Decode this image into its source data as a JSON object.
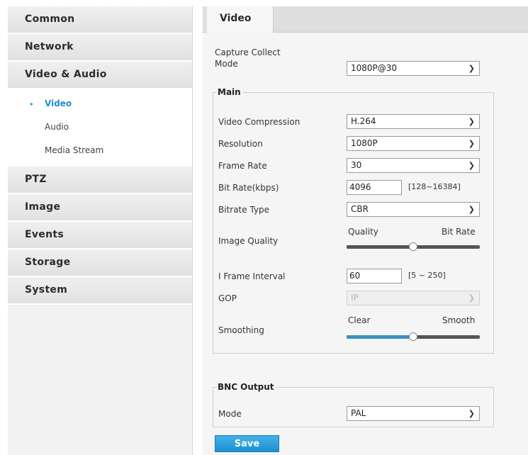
{
  "sidebar": {
    "items": [
      {
        "label": "Common"
      },
      {
        "label": "Network"
      },
      {
        "label": "Video & Audio"
      },
      {
        "label": "PTZ"
      },
      {
        "label": "Image"
      },
      {
        "label": "Events"
      },
      {
        "label": "Storage"
      },
      {
        "label": "System"
      }
    ],
    "sub_items": [
      {
        "label": "Video",
        "active": true
      },
      {
        "label": "Audio"
      },
      {
        "label": "Media Stream"
      }
    ],
    "active_arrow": "▸"
  },
  "tabs": [
    {
      "label": "Video"
    }
  ],
  "capture": {
    "label_line1": "Capture Collect",
    "label_line2": "Mode",
    "value": "1080P@30"
  },
  "main": {
    "legend": "Main",
    "video_compression": {
      "label": "Video Compression",
      "value": "H.264"
    },
    "resolution": {
      "label": "Resolution",
      "value": "1080P"
    },
    "frame_rate": {
      "label": "Frame Rate",
      "value": "30"
    },
    "bit_rate": {
      "label": "Bit Rate(kbps)",
      "value": "4096",
      "range": "[128~16384]"
    },
    "bitrate_type": {
      "label": "Bitrate Type",
      "value": "CBR"
    },
    "image_quality": {
      "label": "Image Quality",
      "left": "Quality",
      "right": "Bit Rate",
      "level": 0.5
    },
    "i_frame_interval": {
      "label": "I Frame Interval",
      "value": "60",
      "range": "[5 ~ 250]"
    },
    "gop": {
      "label": "GOP",
      "value": "IP",
      "disabled": true
    },
    "smoothing": {
      "label": "Smoothing",
      "left": "Clear",
      "right": "Smooth",
      "level": 0.5
    }
  },
  "bnc": {
    "legend": "BNC Output",
    "mode": {
      "label": "Mode",
      "value": "PAL"
    }
  },
  "save_label": "Save",
  "icons": {
    "chevron": "chevron-down-icon"
  },
  "colors": {
    "accent": "#1b8fd1",
    "slider_fill": "#3a8fc4",
    "button": "#2a9ad8"
  }
}
